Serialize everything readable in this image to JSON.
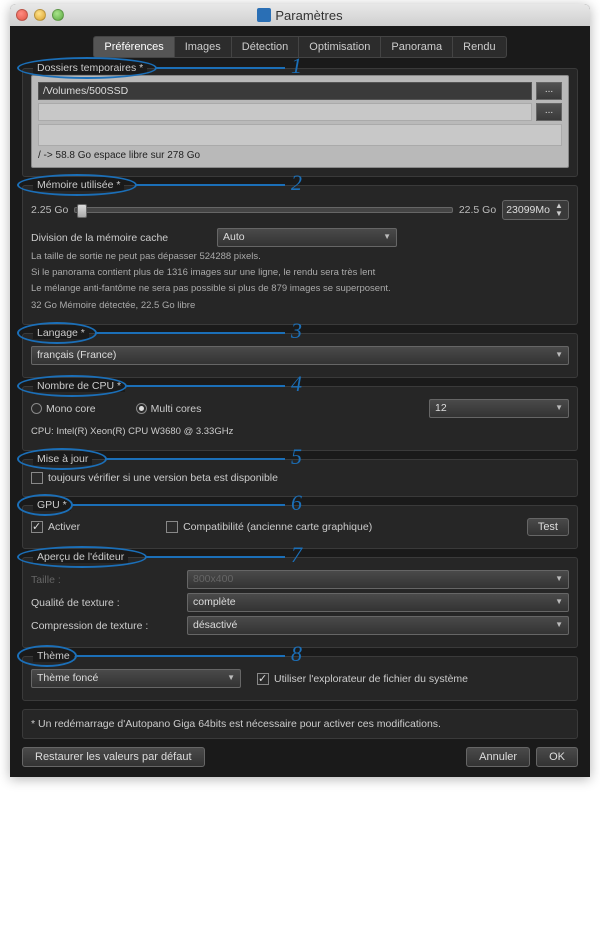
{
  "window": {
    "title": "Paramètres"
  },
  "tabs": [
    "Préférences",
    "Images",
    "Détection",
    "Optimisation",
    "Panorama",
    "Rendu"
  ],
  "active_tab": 0,
  "sections": {
    "temp": {
      "legend": "Dossiers temporaires *",
      "path1": "/Volumes/500SSD",
      "path2": "",
      "browse": "...",
      "info": "/ -> 58.8 Go espace libre sur 278 Go"
    },
    "mem": {
      "legend": "Mémoire utilisée *",
      "min": "2.25 Go",
      "max": "22.5 Go",
      "value": "23099Mo",
      "cache_label": "Division de la mémoire cache",
      "cache_value": "Auto",
      "note1": "La taille de sortie ne peut pas dépasser 524288 pixels.",
      "note2": "Si le panorama contient plus de 1316 images sur une ligne, le rendu sera très lent",
      "note3": "Le mélange anti-fantôme ne sera pas possible si plus de 879 images se superposent.",
      "note4": "32 Go Mémoire détectée, 22.5 Go libre"
    },
    "lang": {
      "legend": "Langage *",
      "value": "français (France)"
    },
    "cpu": {
      "legend": "Nombre de CPU *",
      "mono": "Mono core",
      "multi": "Multi cores",
      "count": "12",
      "info": "CPU:   Intel(R) Xeon(R) CPU        W3680  @ 3.33GHz"
    },
    "update": {
      "legend": "Mise à jour",
      "beta": "toujours vérifier si une version beta est disponible"
    },
    "gpu": {
      "legend": "GPU *",
      "activate": "Activer",
      "compat": "Compatibilité (ancienne carte graphique)",
      "test": "Test"
    },
    "editor": {
      "legend": "Aperçu de l'éditeur",
      "size_label": "Taille :",
      "size_value": "800x400",
      "tex_label": "Qualité de texture :",
      "tex_value": "complète",
      "comp_label": "Compression de texture :",
      "comp_value": "désactivé"
    },
    "theme": {
      "legend": "Thème",
      "value": "Thème foncé",
      "explorer": "Utiliser l'explorateur de fichier du système"
    }
  },
  "restart_note": "* Un redémarrage d'Autopano Giga 64bits est nécessaire pour activer ces modifications.",
  "footer": {
    "restore": "Restaurer les valeurs par défaut",
    "cancel": "Annuler",
    "ok": "OK"
  },
  "annotations": [
    "1",
    "2",
    "3",
    "4",
    "5",
    "6",
    "7",
    "8"
  ]
}
